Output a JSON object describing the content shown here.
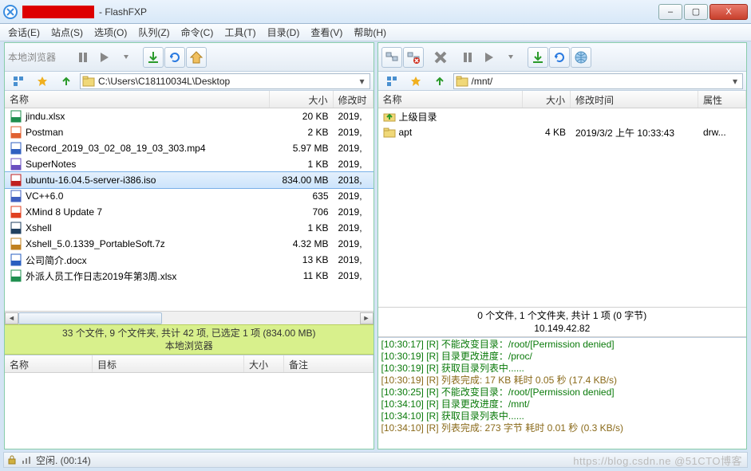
{
  "window": {
    "title": "- FlashFXP",
    "buttons": {
      "min": "–",
      "max": "▢",
      "close": "X"
    }
  },
  "menu": [
    "会话(E)",
    "站点(S)",
    "选项(O)",
    "队列(Z)",
    "命令(C)",
    "工具(T)",
    "目录(D)",
    "查看(V)",
    "帮助(H)"
  ],
  "left": {
    "toolbar_label": "本地浏览器",
    "path": "C:\\Users\\C18110034L\\Desktop",
    "columns": {
      "name": "名称",
      "size": "大小",
      "date": "修改时"
    },
    "files": [
      {
        "icon": "xls",
        "name": "jindu.xlsx",
        "size": "20 KB",
        "date": "2019,"
      },
      {
        "icon": "app",
        "name": "Postman",
        "size": "2 KB",
        "date": "2019,"
      },
      {
        "icon": "mp4",
        "name": "Record_2019_03_02_08_19_03_303.mp4",
        "size": "5.97 MB",
        "date": "2019,"
      },
      {
        "icon": "note",
        "name": "SuperNotes",
        "size": "1 KB",
        "date": "2019,"
      },
      {
        "icon": "iso",
        "name": "ubuntu-16.04.5-server-i386.iso",
        "size": "834.00 MB",
        "date": "2018,",
        "selected": true
      },
      {
        "icon": "vc",
        "name": "VC++6.0",
        "size": "635",
        "date": "2019,"
      },
      {
        "icon": "xm",
        "name": "XMind 8 Update 7",
        "size": "706",
        "date": "2019,"
      },
      {
        "icon": "xsh",
        "name": "Xshell",
        "size": "1 KB",
        "date": "2019,"
      },
      {
        "icon": "zip",
        "name": "Xshell_5.0.1339_PortableSoft.7z",
        "size": "4.32 MB",
        "date": "2019,"
      },
      {
        "icon": "doc",
        "name": "公司简介.docx",
        "size": "13 KB",
        "date": "2019,"
      },
      {
        "icon": "xls",
        "name": "外派人员工作日志2019年第3周.xlsx",
        "size": "11 KB",
        "date": "2019,"
      }
    ],
    "status_line1": "33 个文件, 9 个文件夹, 共计 42 项, 已选定 1 项 (834.00 MB)",
    "status_line2": "本地浏览器",
    "queue_cols": {
      "name": "名称",
      "target": "目标",
      "size": "大小",
      "remark": "备注"
    }
  },
  "right": {
    "path": "/mnt/",
    "columns": {
      "name": "名称",
      "size": "大小",
      "date": "修改时间",
      "attr": "属性"
    },
    "files": [
      {
        "icon": "up",
        "name": "上级目录",
        "size": "",
        "date": "",
        "attr": ""
      },
      {
        "icon": "folder",
        "name": "apt",
        "size": "4 KB",
        "date": "2019/3/2 上午 10:33:43",
        "attr": "drw..."
      }
    ],
    "status_line1": "0 个文件, 1 个文件夹, 共计 1 项 (0 字节)",
    "status_line2": "10.149.42.82",
    "log": [
      {
        "cls": "green",
        "text": "[10:30:17] [R] 不能改变目录：/root/[Permission denied]"
      },
      {
        "cls": "green",
        "text": "[10:30:19] [R] 目录更改进度：/proc/"
      },
      {
        "cls": "green",
        "text": "[10:30:19] [R] 获取目录列表中......"
      },
      {
        "cls": "brown",
        "text": "[10:30:19] [R] 列表完成: 17 KB 耗时 0.05 秒 (17.4 KB/s)"
      },
      {
        "cls": "green",
        "text": "[10:30:25] [R] 不能改变目录：/root/[Permission denied]"
      },
      {
        "cls": "green",
        "text": "[10:34:10] [R] 目录更改进度：/mnt/"
      },
      {
        "cls": "green",
        "text": "[10:34:10] [R] 获取目录列表中......"
      },
      {
        "cls": "brown",
        "text": "[10:34:10] [R] 列表完成: 273 字节 耗时 0.01 秒 (0.3 KB/s)"
      }
    ]
  },
  "statusbar": {
    "text": "空闲. (00:14)",
    "watermark": "https://blog.csdn.ne @51CTO博客"
  }
}
